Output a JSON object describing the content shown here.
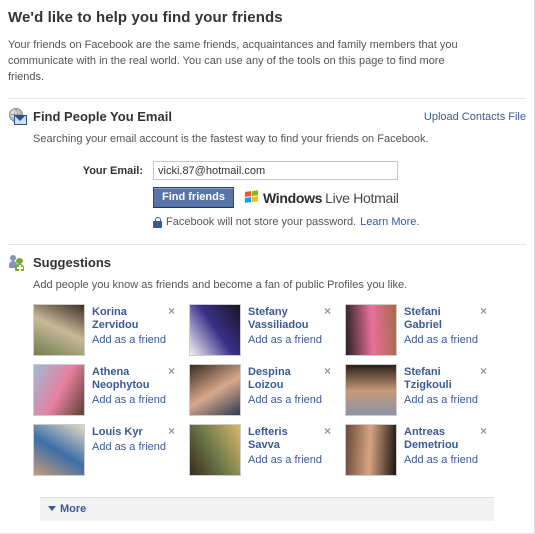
{
  "page": {
    "title": "We'd like to help you find your friends",
    "intro": "Your friends on Facebook are the same friends, acquaintances and family members that you communicate with in the real world. You can use any of the tools on this page to find more friends."
  },
  "find_email": {
    "icon": "globe-envelope-icon",
    "title": "Find People You Email",
    "upload_link": "Upload Contacts File",
    "subtitle": "Searching your email account is the fastest way to find your friends on Facebook.",
    "email_label": "Your Email:",
    "email_value": "vicki.87@hotmail.com",
    "email_placeholder": "",
    "find_button": "Find friends",
    "provider_bold": "Windows",
    "provider_light": "Live Hotmail",
    "privacy_note": "Facebook will not store your password.",
    "learn_more": "Learn More."
  },
  "suggestions": {
    "icon": "add-friend-icon",
    "title": "Suggestions",
    "subtitle": "Add people you know as friends and become a fan of public Profiles you like.",
    "action_label": "Add as a friend",
    "close_label": "×",
    "people": [
      {
        "name": "Korina Zervidou",
        "action": "Add as a friend",
        "photo_c1": "#6f7f4c",
        "photo_c2": "#c8b89a",
        "photo_c3": "#3d3026"
      },
      {
        "name": "Stefany Vassiliadou",
        "action": "Add as a friend",
        "photo_c1": "#f2f2f2",
        "photo_c2": "#3a2f88",
        "photo_c3": "#1a1520"
      },
      {
        "name": "Stefani Gabriel",
        "action": "Add as a friend",
        "photo_c1": "#2a2224",
        "photo_c2": "#e8709a",
        "photo_c3": "#a86a4a"
      },
      {
        "name": "Athena Neophytou",
        "action": "Add as a friend",
        "photo_c1": "#9fb9d6",
        "photo_c2": "#e87fa0",
        "photo_c3": "#5a4233"
      },
      {
        "name": "Despina Loizou",
        "action": "Add as a friend",
        "photo_c1": "#3a2b22",
        "photo_c2": "#d8a88a",
        "photo_c3": "#2d3b52"
      },
      {
        "name": "Stefani Tzigkouli",
        "action": "Add as a friend",
        "photo_c1": "#2b2018",
        "photo_c2": "#c79a7a",
        "photo_c3": "#8a93a8"
      },
      {
        "name": "Louis Kyr",
        "action": "Add as a friend",
        "photo_c1": "#e8d9c6",
        "photo_c2": "#3c6ea8",
        "photo_c3": "#c79b7c"
      },
      {
        "name": "Lefteris Savva",
        "action": "Add as a friend",
        "photo_c1": "#d9b76a",
        "photo_c2": "#6f7a4a",
        "photo_c3": "#3a2a1e"
      },
      {
        "name": "Antreas Demetriou",
        "action": "Add as a friend",
        "photo_c1": "#1c1410",
        "photo_c2": "#d6a483",
        "photo_c3": "#6b4a38"
      }
    ]
  },
  "footer": {
    "more_label": "More"
  },
  "colors": {
    "link": "#3b5998",
    "button": "#5b74a8",
    "button_border": "#29447e"
  }
}
